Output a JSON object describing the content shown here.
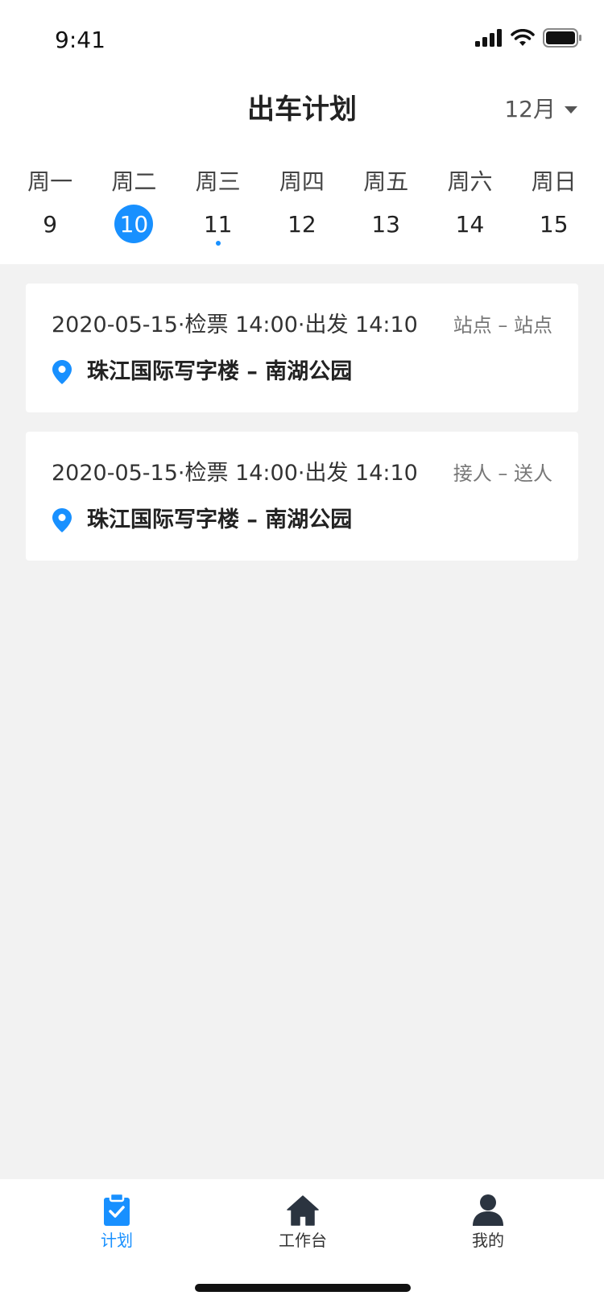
{
  "status": {
    "time": "9:41"
  },
  "header": {
    "title": "出车计划",
    "month": "12月"
  },
  "week": [
    {
      "weekday": "周一",
      "date": "9",
      "selected": false,
      "has_event": false
    },
    {
      "weekday": "周二",
      "date": "10",
      "selected": true,
      "has_event": false
    },
    {
      "weekday": "周三",
      "date": "11",
      "selected": false,
      "has_event": true
    },
    {
      "weekday": "周四",
      "date": "12",
      "selected": false,
      "has_event": false
    },
    {
      "weekday": "周五",
      "date": "13",
      "selected": false,
      "has_event": false
    },
    {
      "weekday": "周六",
      "date": "14",
      "selected": false,
      "has_event": false
    },
    {
      "weekday": "周日",
      "date": "15",
      "selected": false,
      "has_event": false
    }
  ],
  "trips": [
    {
      "schedule": "2020-05-15·检票 14:00·出发 14:10",
      "type": "站点 – 站点",
      "route": "珠江国际写字楼 – 南湖公园"
    },
    {
      "schedule": "2020-05-15·检票 14:00·出发 14:10",
      "type": "接人 – 送人",
      "route": "珠江国际写字楼 – 南湖公园"
    }
  ],
  "tabs": [
    {
      "label": "计划",
      "icon": "clipboard-check-icon",
      "active": true
    },
    {
      "label": "工作台",
      "icon": "home-icon",
      "active": false
    },
    {
      "label": "我的",
      "icon": "user-icon",
      "active": false
    }
  ],
  "colors": {
    "accent": "#1890ff",
    "page_background": "#f2f2f2",
    "card_background": "#ffffff"
  }
}
